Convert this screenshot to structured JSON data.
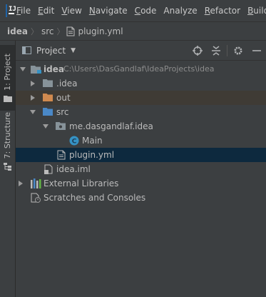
{
  "menu": {
    "items": [
      {
        "mnemonic": "F",
        "rest": "ile"
      },
      {
        "mnemonic": "E",
        "rest": "dit"
      },
      {
        "mnemonic": "V",
        "rest": "iew"
      },
      {
        "mnemonic": "N",
        "rest": "avigate"
      },
      {
        "mnemonic": "C",
        "rest": "ode"
      },
      {
        "mnemonic": "",
        "rest": "Analyze"
      },
      {
        "mnemonic": "R",
        "rest": "efactor"
      },
      {
        "mnemonic": "B",
        "rest": "uild"
      }
    ]
  },
  "navbar": {
    "crumbs": [
      "idea",
      "src",
      "plugin.yml"
    ]
  },
  "leftstrip": {
    "project_tab": "1: Project",
    "structure_tab": "7: Structure"
  },
  "toolwindow": {
    "title": "Project"
  },
  "tree": {
    "root_label": "idea",
    "root_path": "C:\\Users\\DasGandlaf\\IdeaProjects\\idea",
    "idea_dir": ".idea",
    "out_dir": "out",
    "src_dir": "src",
    "package": "me.dasgandlaf.idea",
    "main_class": "Main",
    "plugin_file": "plugin.yml",
    "iml_file": "idea.iml",
    "external_libraries": "External Libraries",
    "scratches": "Scratches and Consoles"
  },
  "colors": {
    "background": "#3c3f41",
    "selection": "#0d293e",
    "excluded_row": "#3f3b35",
    "folder_blue": "#87939a",
    "folder_excluded": "#d18a4f",
    "class_icon": "#3592c4"
  }
}
